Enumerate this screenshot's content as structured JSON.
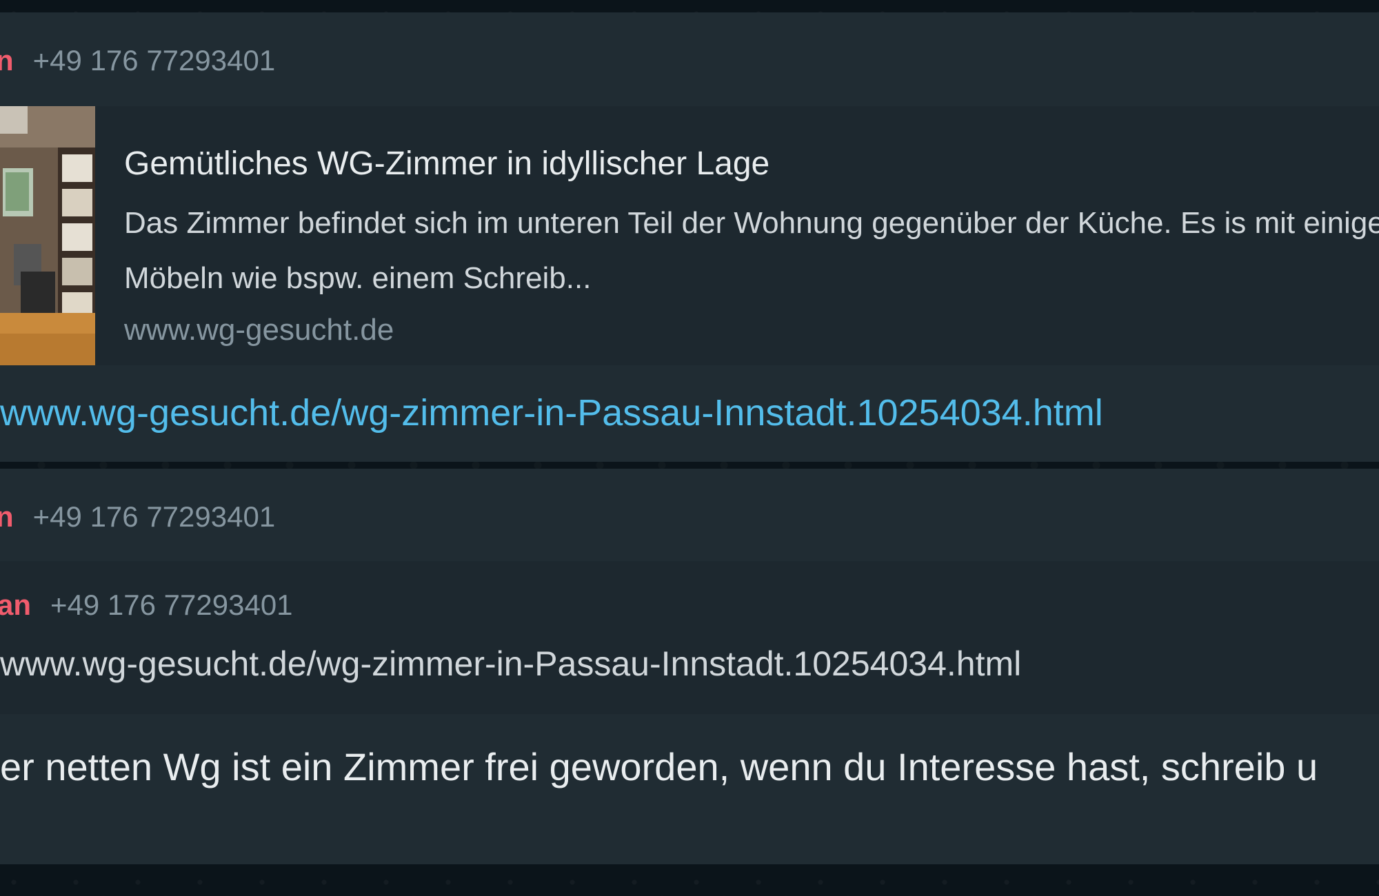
{
  "colors": {
    "background": "#0b141a",
    "bubble": "#202c33",
    "quote_bg": "#1d282f",
    "sender_name": "#f15c6d",
    "link": "#53bdeb",
    "muted": "#8696a0"
  },
  "message1": {
    "sender_name": "n",
    "sender_phone": "+49 176 77293401",
    "preview": {
      "thumbnail_icon": "room-photo",
      "title": "Gemütliches WG-Zimmer in idyllischer Lage",
      "description": "Das Zimmer befindet sich im unteren Teil der Wohnung gegenüber der Küche. Es is mit einigen Möbeln wie bspw. einem Schreib...",
      "domain": "www.wg-gesucht.de"
    },
    "link_text": "www.wg-gesucht.de/wg-zimmer-in-Passau-Innstadt.10254034.html"
  },
  "message2": {
    "sender_name": "n",
    "sender_phone": "+49 176 77293401",
    "quoted": {
      "sender_name": "an",
      "sender_phone": "+49 176 77293401",
      "text": "www.wg-gesucht.de/wg-zimmer-in-Passau-Innstadt.10254034.html"
    },
    "text": "er netten Wg ist ein Zimmer frei geworden, wenn du Interesse hast, schreib u"
  }
}
